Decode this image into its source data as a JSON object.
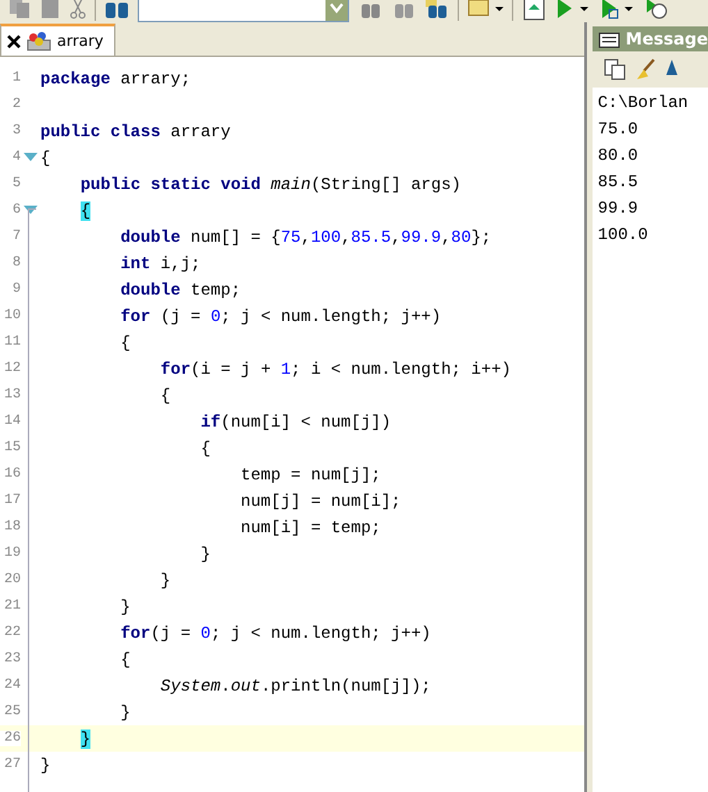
{
  "tabs": [
    {
      "label": "arrary",
      "selected": true
    }
  ],
  "editor": {
    "lines": [
      {
        "number": "1",
        "current": false,
        "fold": false,
        "tokens": [
          {
            "kind": "kw",
            "text": "package"
          },
          {
            "kind": "plain",
            "text": " arrary;"
          }
        ]
      },
      {
        "number": "2",
        "current": false,
        "fold": false
      },
      {
        "number": "3",
        "current": false,
        "fold": false,
        "tokens": [
          {
            "kind": "kw",
            "text": "public class"
          },
          {
            "kind": "plain",
            "text": " arrary"
          }
        ]
      },
      {
        "number": "4",
        "current": false,
        "fold": true,
        "tokens": [
          {
            "kind": "plain",
            "text": "{"
          }
        ]
      },
      {
        "number": "5",
        "current": false,
        "fold": false,
        "tokens": [
          {
            "kind": "kw",
            "text": "    public static void"
          },
          {
            "kind": "italic",
            "text": " main"
          },
          {
            "kind": "plain",
            "text": "(String[] args)"
          }
        ]
      },
      {
        "number": "6",
        "current": false,
        "fold": true,
        "tokens": [
          {
            "kind": "match",
            "text": "    {"
          }
        ]
      },
      {
        "number": "7",
        "current": false,
        "fold": false,
        "tokens": [
          {
            "kind": "kw",
            "text": "        double"
          },
          {
            "kind": "plain",
            "text": " num[] = {"
          },
          {
            "kind": "num",
            "text": "75"
          },
          {
            "kind": "plain",
            "text": ","
          },
          {
            "kind": "num",
            "text": "100"
          },
          {
            "kind": "plain",
            "text": ","
          },
          {
            "kind": "num",
            "text": "85.5"
          },
          {
            "kind": "plain",
            "text": ","
          },
          {
            "kind": "num",
            "text": "99.9"
          },
          {
            "kind": "plain",
            "text": ","
          },
          {
            "kind": "num",
            "text": "80"
          },
          {
            "kind": "plain",
            "text": "};"
          }
        ]
      },
      {
        "number": "8",
        "current": false,
        "fold": false,
        "tokens": [
          {
            "kind": "kw",
            "text": "        int"
          },
          {
            "kind": "plain",
            "text": " i,j;"
          }
        ]
      },
      {
        "number": "9",
        "current": false,
        "fold": false,
        "tokens": [
          {
            "kind": "kw",
            "text": "        double"
          },
          {
            "kind": "plain",
            "text": " temp;"
          }
        ]
      },
      {
        "number": "10",
        "current": false,
        "fold": false,
        "tokens": [
          {
            "kind": "kw",
            "text": "        for"
          },
          {
            "kind": "plain",
            "text": " (j = "
          },
          {
            "kind": "num",
            "text": "0"
          },
          {
            "kind": "plain",
            "text": "; j < num.length; j++)"
          }
        ]
      },
      {
        "number": "11",
        "current": false,
        "fold": false,
        "tokens": [
          {
            "kind": "plain",
            "text": "        {"
          }
        ]
      },
      {
        "number": "12",
        "current": false,
        "fold": false,
        "tokens": [
          {
            "kind": "kw",
            "text": "            for"
          },
          {
            "kind": "plain",
            "text": "(i = j + "
          },
          {
            "kind": "num",
            "text": "1"
          },
          {
            "kind": "plain",
            "text": "; i < num.length; i++)"
          }
        ]
      },
      {
        "number": "13",
        "current": false,
        "fold": false,
        "tokens": [
          {
            "kind": "plain",
            "text": "            {"
          }
        ]
      },
      {
        "number": "14",
        "current": false,
        "fold": false,
        "tokens": [
          {
            "kind": "kw",
            "text": "                if"
          },
          {
            "kind": "plain",
            "text": "(num[i] < num[j])"
          }
        ]
      },
      {
        "number": "15",
        "current": false,
        "fold": false,
        "tokens": [
          {
            "kind": "plain",
            "text": "                {"
          }
        ]
      },
      {
        "number": "16",
        "current": false,
        "fold": false,
        "tokens": [
          {
            "kind": "plain",
            "text": "                    temp = num[j];"
          }
        ]
      },
      {
        "number": "17",
        "current": false,
        "fold": false,
        "tokens": [
          {
            "kind": "plain",
            "text": "                    num[j] = num[i];"
          }
        ]
      },
      {
        "number": "18",
        "current": false,
        "fold": false,
        "tokens": [
          {
            "kind": "plain",
            "text": "                    num[i] = temp;"
          }
        ]
      },
      {
        "number": "19",
        "current": false,
        "fold": false,
        "tokens": [
          {
            "kind": "plain",
            "text": "                }"
          }
        ]
      },
      {
        "number": "20",
        "current": false,
        "fold": false,
        "tokens": [
          {
            "kind": "plain",
            "text": "            }"
          }
        ]
      },
      {
        "number": "21",
        "current": false,
        "fold": false,
        "tokens": [
          {
            "kind": "plain",
            "text": "        }"
          }
        ]
      },
      {
        "number": "22",
        "current": false,
        "fold": false,
        "tokens": [
          {
            "kind": "kw",
            "text": "        for"
          },
          {
            "kind": "plain",
            "text": "(j = "
          },
          {
            "kind": "num",
            "text": "0"
          },
          {
            "kind": "plain",
            "text": "; j < num.length; j++)"
          }
        ]
      },
      {
        "number": "23",
        "current": false,
        "fold": false,
        "tokens": [
          {
            "kind": "plain",
            "text": "        {"
          }
        ]
      },
      {
        "number": "24",
        "current": false,
        "fold": false,
        "tokens": [
          {
            "kind": "italic",
            "text": "            System"
          },
          {
            "kind": "plain",
            "text": "."
          },
          {
            "kind": "italic",
            "text": "out"
          },
          {
            "kind": "plain",
            "text": ".println(num[j]);"
          }
        ]
      },
      {
        "number": "25",
        "current": false,
        "fold": false,
        "tokens": [
          {
            "kind": "plain",
            "text": "        }"
          }
        ]
      },
      {
        "number": "26",
        "current": true,
        "fold": false,
        "tokens": [
          {
            "kind": "match",
            "text": "    }"
          }
        ]
      },
      {
        "number": "27",
        "current": false,
        "fold": false,
        "tokens": [
          {
            "kind": "plain",
            "text": "}"
          }
        ]
      }
    ]
  },
  "messages": {
    "title": "Message",
    "lines": [
      "C:\\Borlan",
      "75.0",
      "80.0",
      "85.5",
      "99.9",
      "100.0"
    ]
  }
}
